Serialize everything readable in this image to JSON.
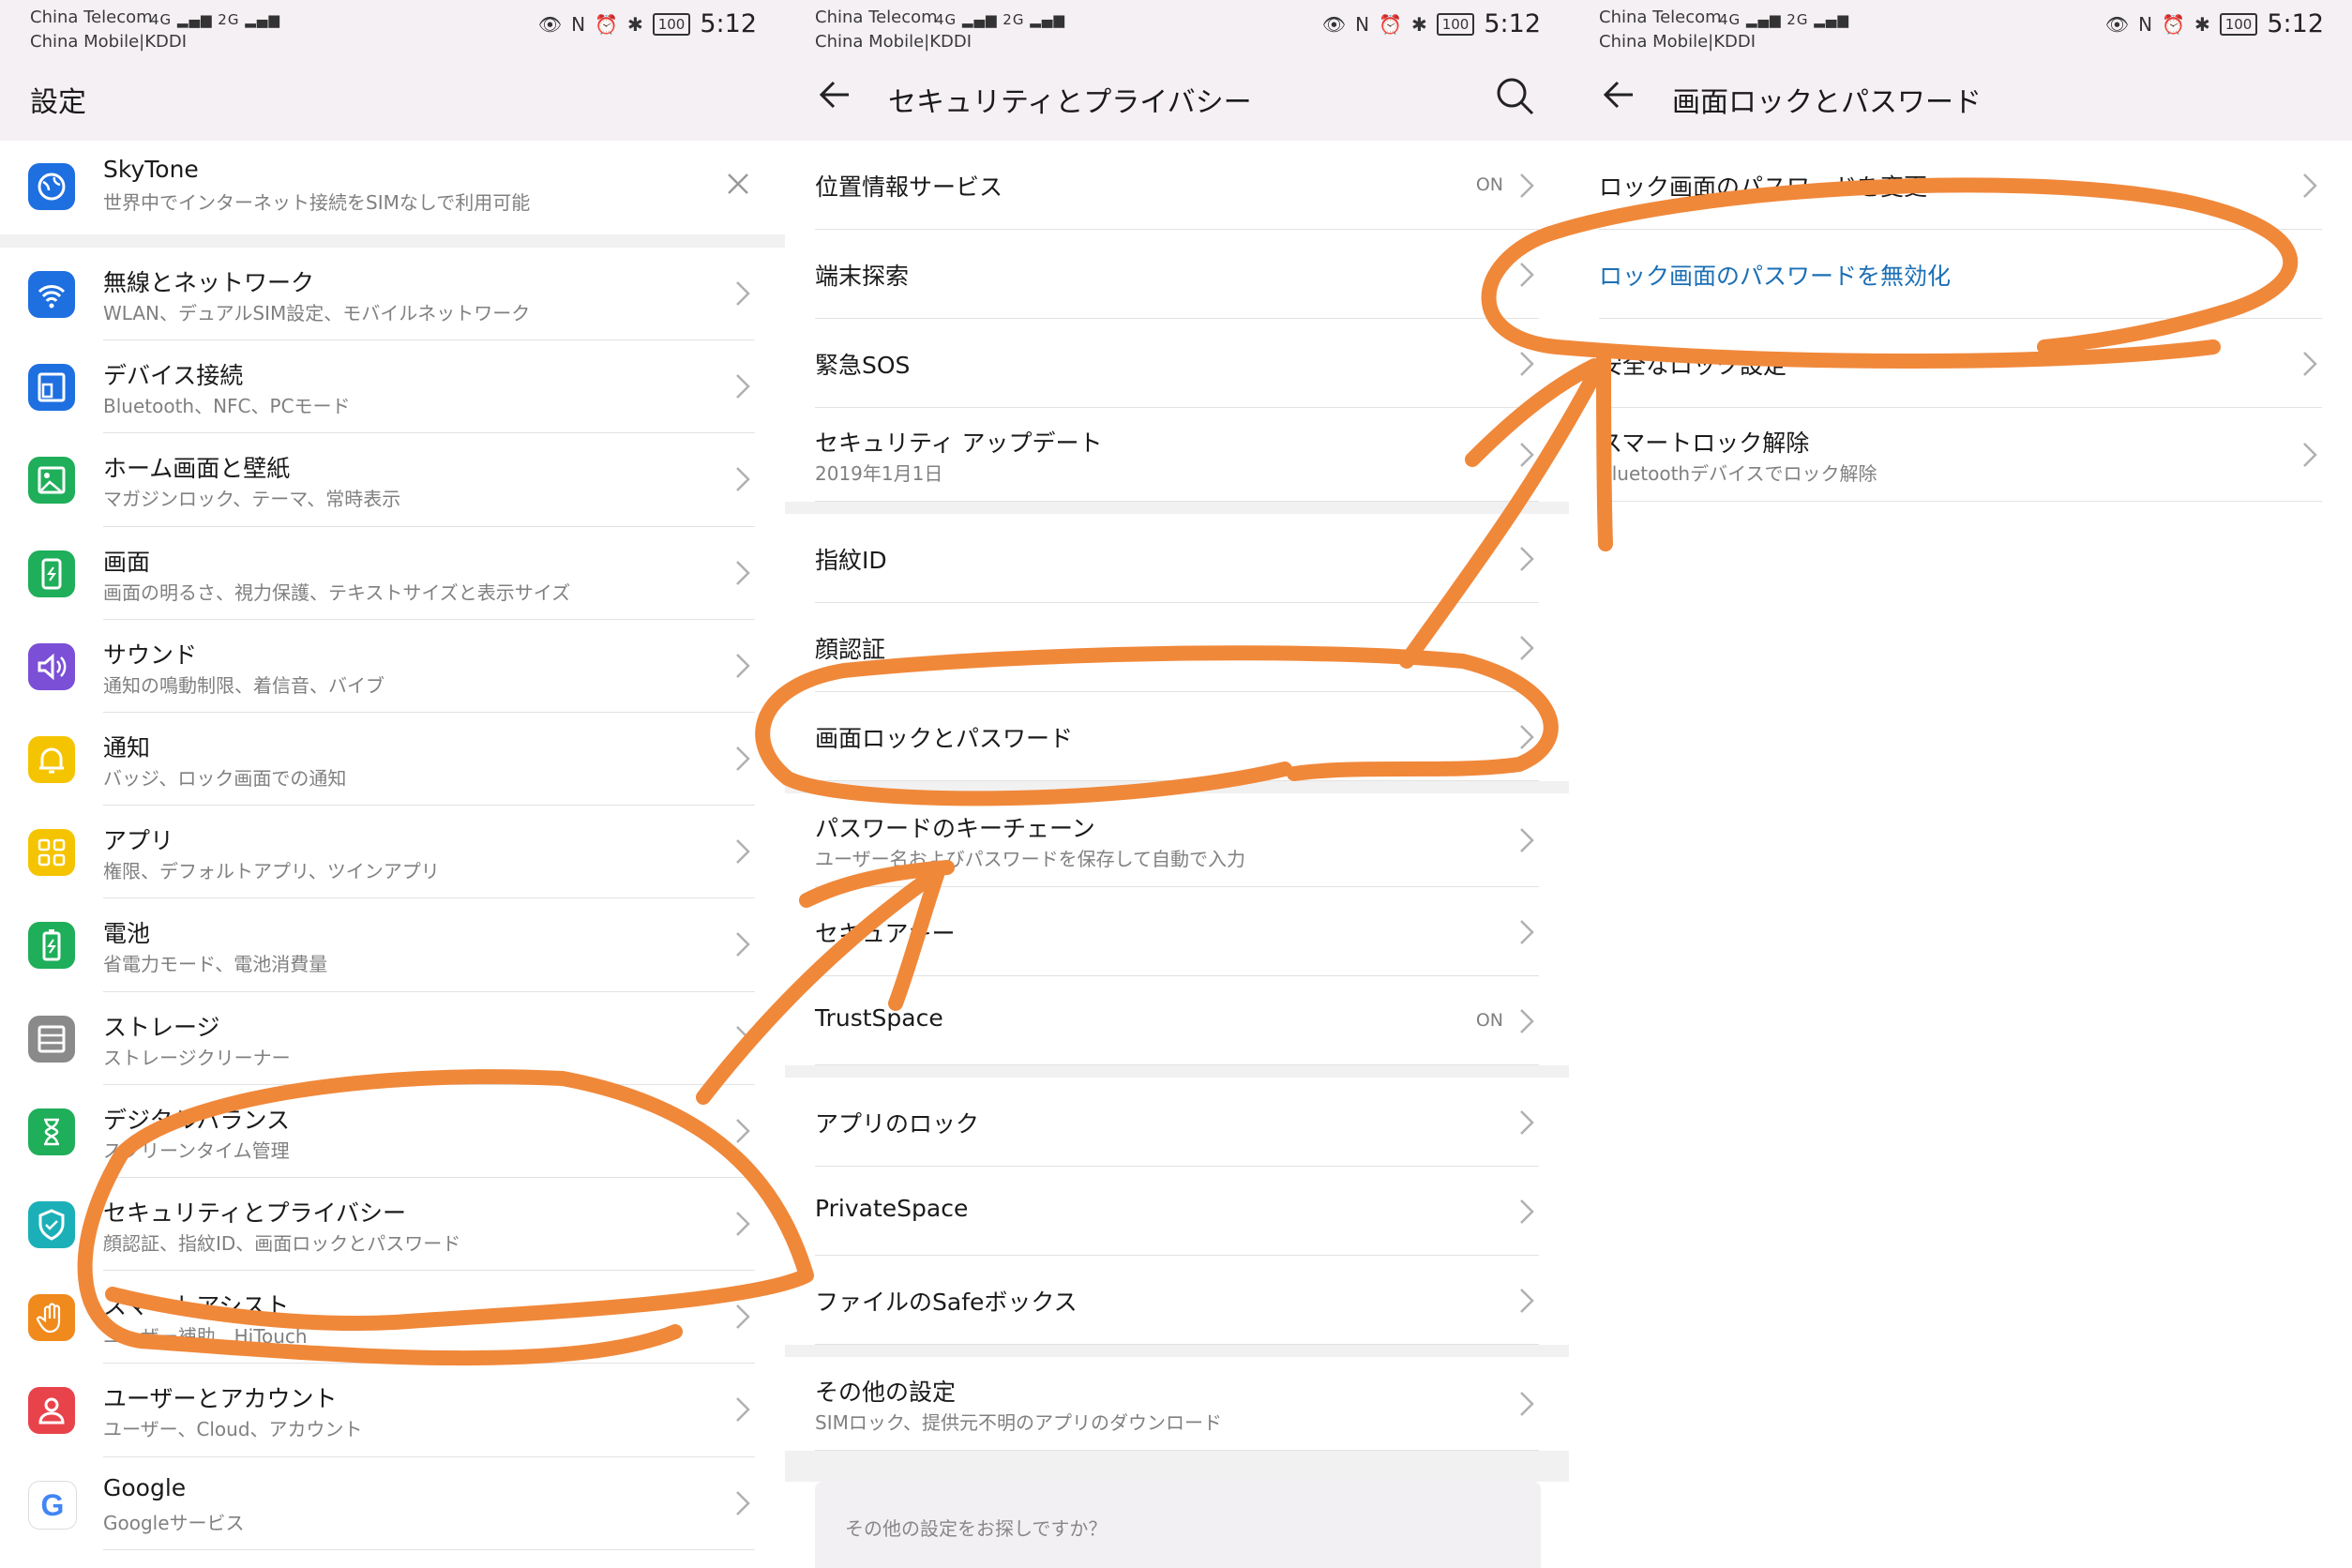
{
  "status_bar": {
    "carrier_1": "China Telecom",
    "carrier_2": "China Mobile|KDDI",
    "signal_text": "4G ▂▄▆ 2G ▂▄▆",
    "battery": "100",
    "time": "5:12"
  },
  "panel1": {
    "title": "設定",
    "skytone": {
      "title": "SkyTone",
      "subtitle": "世界中でインターネット接続をSIMなしで利用可能"
    },
    "items": [
      {
        "title": "無線とネットワーク",
        "subtitle": "WLAN、デュアルSIM設定、モバイルネットワーク",
        "icon": "wifi-icon",
        "color": "#1e6fe0"
      },
      {
        "title": "デバイス接続",
        "subtitle": "Bluetooth、NFC、PCモード",
        "icon": "device-connection-icon",
        "color": "#1e6fe0"
      },
      {
        "title": "ホーム画面と壁紙",
        "subtitle": "マガジンロック、テーマ、常時表示",
        "icon": "wallpaper-icon",
        "color": "#1fae5a"
      },
      {
        "title": "画面",
        "subtitle": "画面の明るさ、視力保護、テキストサイズと表示サイズ",
        "icon": "display-icon",
        "color": "#1fae5a"
      },
      {
        "title": "サウンド",
        "subtitle": "通知の鳴動制限、着信音、バイブ",
        "icon": "sound-icon",
        "color": "#7b4fd6"
      },
      {
        "title": "通知",
        "subtitle": "バッジ、ロック画面での通知",
        "icon": "bell-icon",
        "color": "#f5c400"
      },
      {
        "title": "アプリ",
        "subtitle": "権限、デフォルトアプリ、ツインアプリ",
        "icon": "apps-icon",
        "color": "#f5c400"
      },
      {
        "title": "電池",
        "subtitle": "省電力モード、電池消費量",
        "icon": "battery-icon",
        "color": "#1fae5a"
      },
      {
        "title": "ストレージ",
        "subtitle": "ストレージクリーナー",
        "icon": "storage-icon",
        "color": "#8a8a8a"
      },
      {
        "title": "デジタルバランス",
        "subtitle": "スクリーンタイム管理",
        "icon": "hourglass-icon",
        "color": "#1fae5a"
      },
      {
        "title": "セキュリティとプライバシー",
        "subtitle": "顔認証、指紋ID、画面ロックとパスワード",
        "icon": "shield-icon",
        "color": "#1bb0b8"
      },
      {
        "title": "スマートアシスト",
        "subtitle": "ユーザー補助、HiTouch",
        "icon": "hand-icon",
        "color": "#f08a1c"
      },
      {
        "title": "ユーザーとアカウント",
        "subtitle": "ユーザー、Cloud、アカウント",
        "icon": "user-icon",
        "color": "#e8434a"
      },
      {
        "title": "Google",
        "subtitle": "Googleサービス",
        "icon": "google-icon",
        "color": "#ffffff"
      }
    ]
  },
  "panel2": {
    "title": "セキュリティとプライバシー",
    "on_label": "ON",
    "items": [
      {
        "title": "位置情報サービス",
        "subtitle": "",
        "on": true
      },
      {
        "title": "端末探索",
        "subtitle": "",
        "on": false
      },
      {
        "title": "緊急SOS",
        "subtitle": "",
        "on": false
      },
      {
        "title": "セキュリティ アップデート",
        "subtitle": "2019年1月1日",
        "on": false
      },
      {
        "title": "指紋ID",
        "subtitle": "",
        "on": false
      },
      {
        "title": "顔認証",
        "subtitle": "",
        "on": false
      },
      {
        "title": "画面ロックとパスワード",
        "subtitle": "",
        "on": false
      },
      {
        "title": "パスワードのキーチェーン",
        "subtitle": "ユーザー名およびパスワードを保存して自動で入力",
        "on": false
      },
      {
        "title": "セキュアキー",
        "subtitle": "",
        "on": false
      },
      {
        "title": "TrustSpace",
        "subtitle": "",
        "on": true
      },
      {
        "title": "アプリのロック",
        "subtitle": "",
        "on": false
      },
      {
        "title": "PrivateSpace",
        "subtitle": "",
        "on": false
      },
      {
        "title": "ファイルのSafeボックス",
        "subtitle": "",
        "on": false
      },
      {
        "title": "その他の設定",
        "subtitle": "SIMロック、提供元不明のアプリのダウンロード",
        "on": false
      }
    ],
    "search_hint": "その他の設定をお探しですか？"
  },
  "panel3": {
    "title": "画面ロックとパスワード",
    "items": [
      {
        "title": "ロック画面のパスワードを変更",
        "subtitle": "",
        "highlight": false
      },
      {
        "title": "ロック画面のパスワードを無効化",
        "subtitle": "",
        "highlight": true
      },
      {
        "title": "安全なロック設定",
        "subtitle": "",
        "highlight": false
      },
      {
        "title": "スマートロック解除",
        "subtitle": "Bluetoothデバイスでロック解除",
        "highlight": false
      }
    ]
  },
  "annotation": {
    "stroke_color": "#f0883a"
  }
}
